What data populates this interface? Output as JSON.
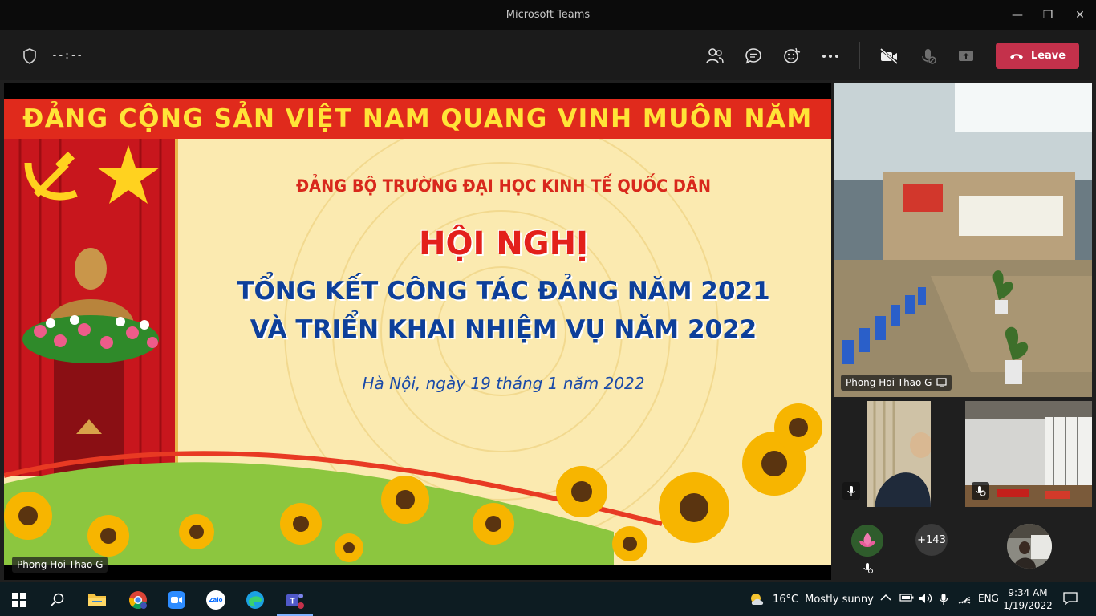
{
  "window": {
    "title": "Microsoft Teams",
    "minimize_glyph": "—",
    "restore_glyph": "❐",
    "close_glyph": "✕"
  },
  "meeting_bar": {
    "timer": "--:--",
    "leave_label": "Leave",
    "icons": [
      "people-icon",
      "chat-icon",
      "reactions-icon",
      "more-icon",
      "camera-off-icon",
      "mic-off-icon",
      "share-icon"
    ]
  },
  "slide": {
    "banner": "ĐẢNG CỘNG SẢN VIỆT NAM QUANG VINH MUÔN NĂM",
    "org": "ĐẢNG BỘ TRƯỜNG ĐẠI HỌC KINH TẾ QUỐC DÂN",
    "heading": "HỘI NGHỊ",
    "line1": "TỔNG KẾT CÔNG TÁC ĐẢNG NĂM 2021",
    "line2": "VÀ TRIỂN KHAI NHIỆM VỤ NĂM 2022",
    "date": "Hà Nội, ngày 19 tháng 1 năm 2022",
    "presenter_label": "Phong Hoi Thao G"
  },
  "participants": {
    "main_tile_label": "Phong Hoi Thao G",
    "overflow_count": "+143"
  },
  "taskbar": {
    "weather_temp": "16°C",
    "weather_text": "Mostly sunny",
    "language": "ENG",
    "time": "9:34 AM",
    "date": "1/19/2022",
    "zalo_label": "Zalo"
  },
  "colors": {
    "leave": "#c4314b",
    "banner_red": "#e02a1c",
    "banner_text": "#ffe438",
    "slide_blue": "#0d3f9a",
    "taskbar": "#0d1c22"
  }
}
